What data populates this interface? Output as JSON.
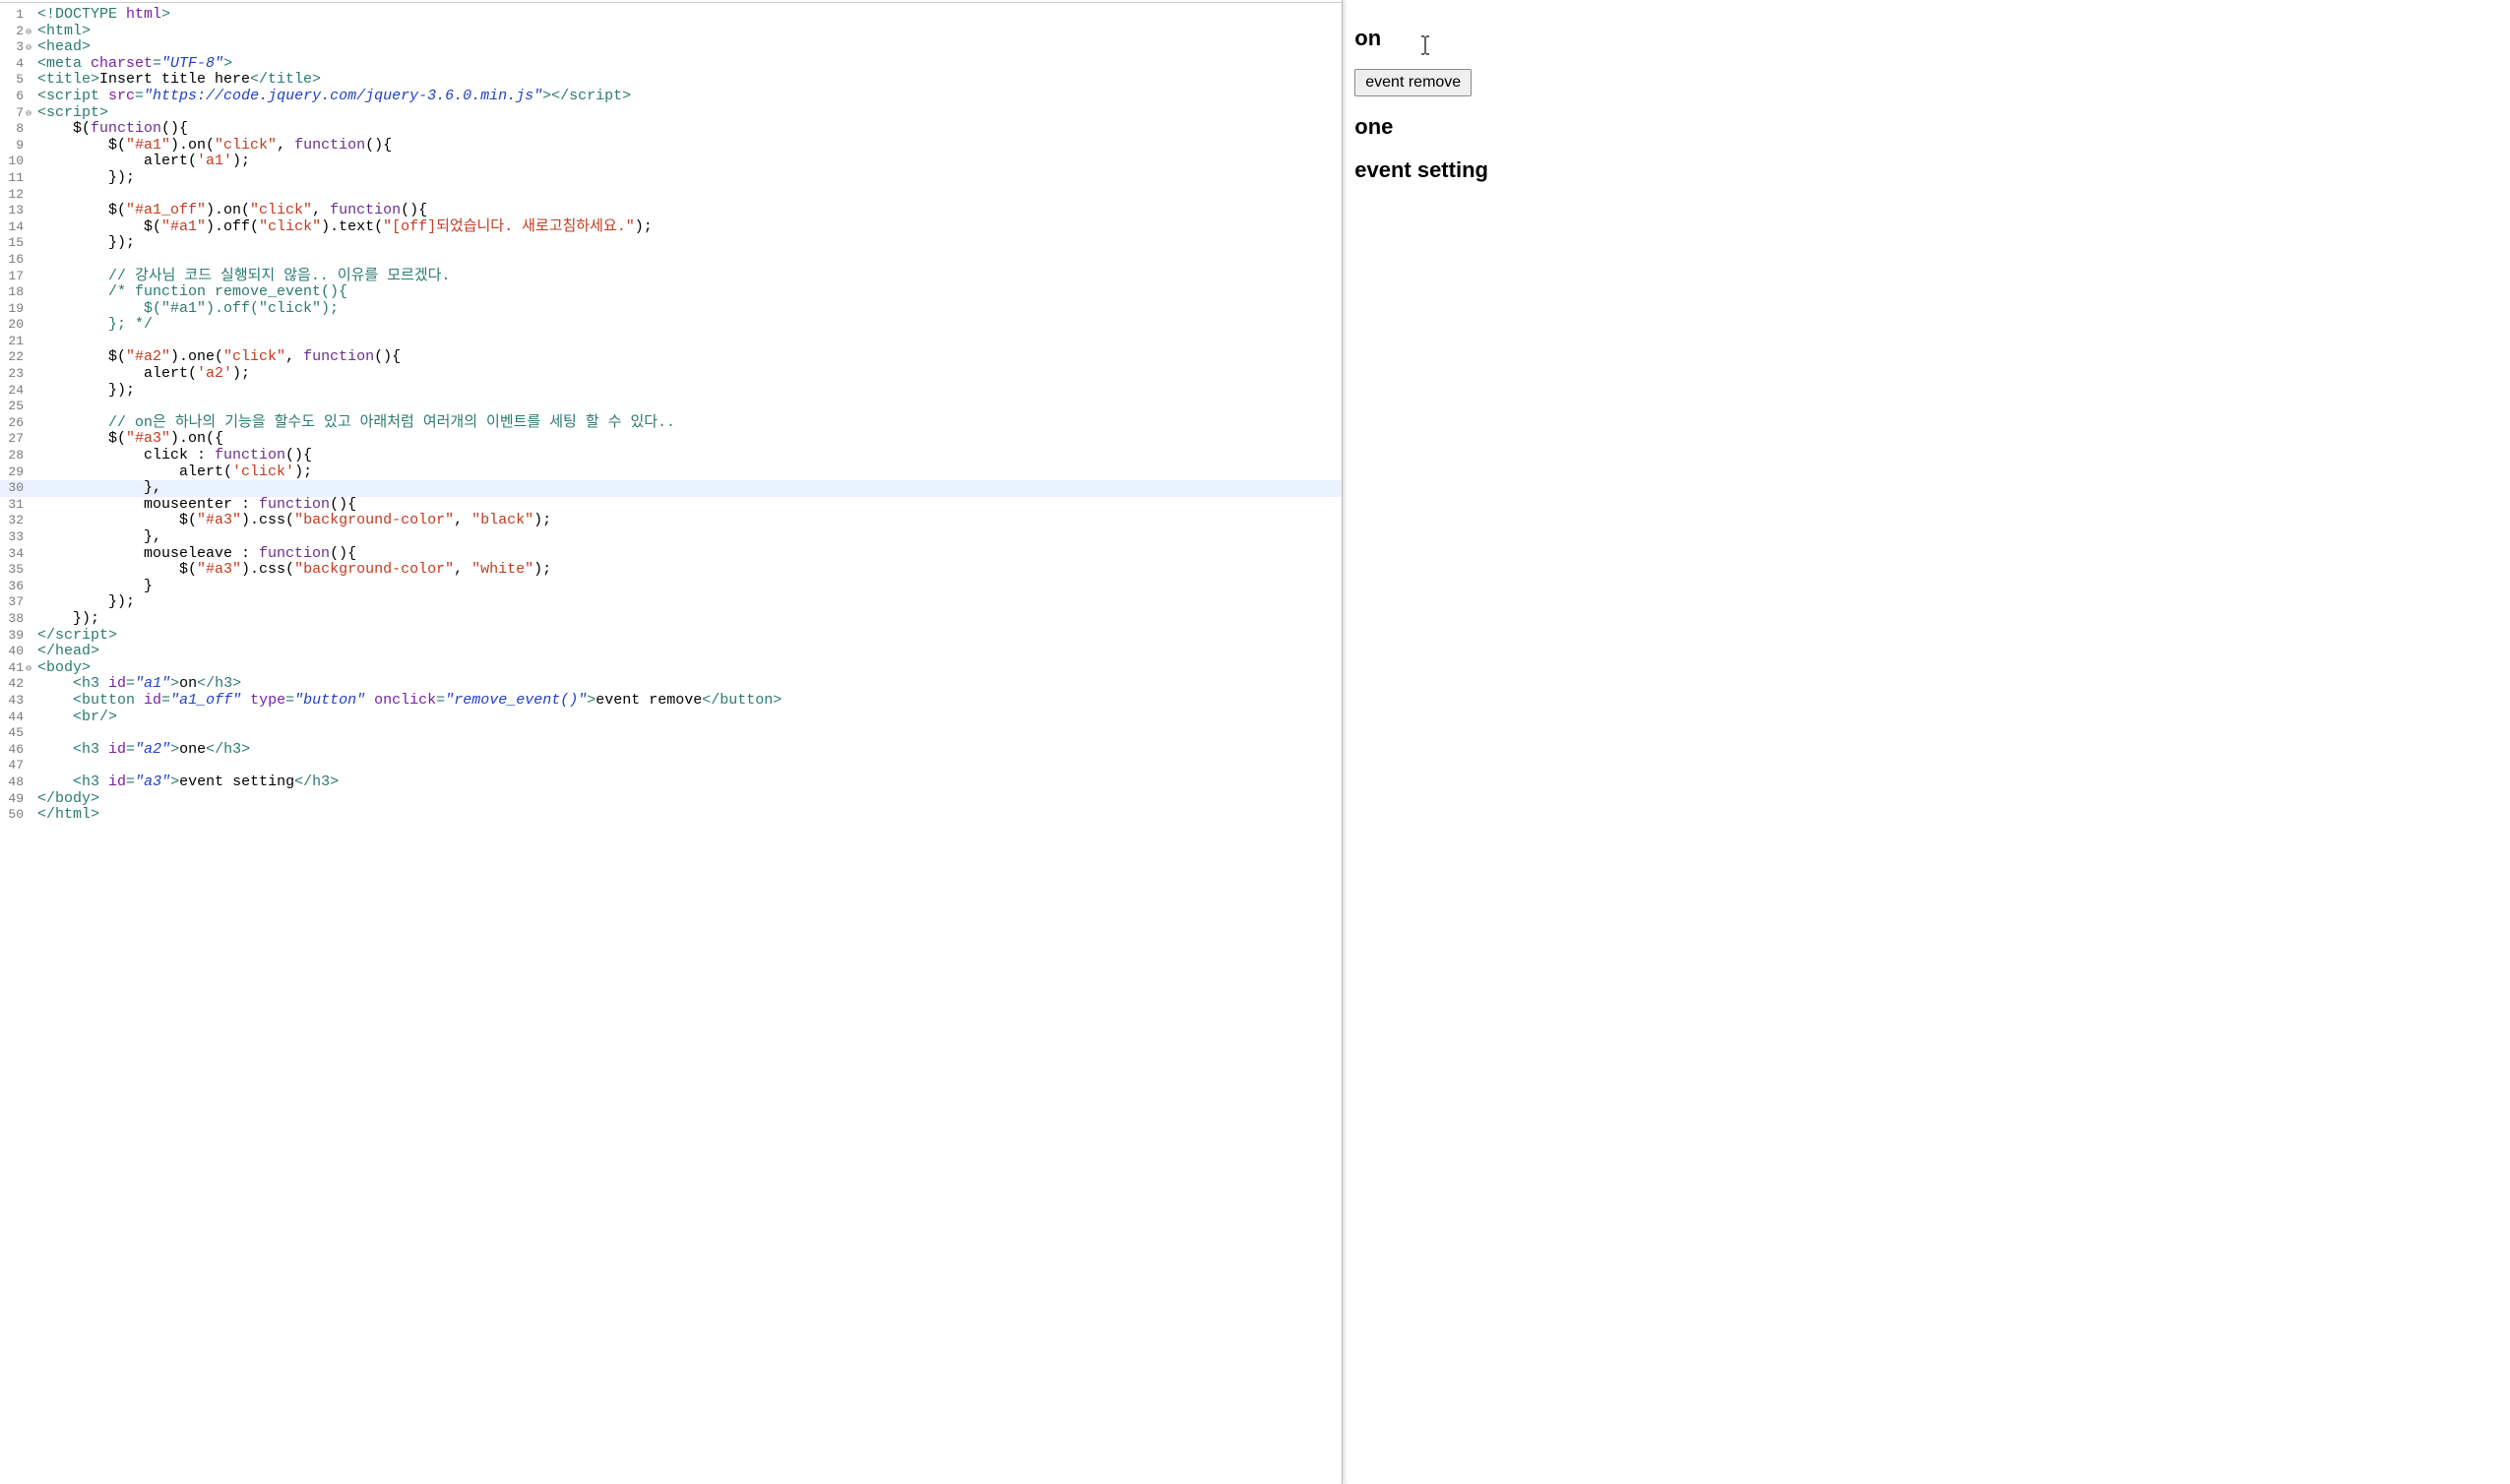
{
  "preview": {
    "h_on": "on",
    "btn_remove": "event remove",
    "h_one": "one",
    "h_setting": "event setting"
  },
  "fold_marks": {
    "1": "",
    "2": "⊖",
    "3": "⊖",
    "7": "⊖",
    "41": "⊖"
  },
  "code": [
    {
      "n": 1,
      "seg": [
        [
          "c-tag",
          "<!DOCTYPE "
        ],
        [
          "c-attr",
          "html"
        ],
        [
          "c-tag",
          ">"
        ]
      ]
    },
    {
      "n": 2,
      "seg": [
        [
          "c-tag",
          "<html>"
        ]
      ]
    },
    {
      "n": 3,
      "seg": [
        [
          "c-tag",
          "<head>"
        ]
      ]
    },
    {
      "n": 4,
      "seg": [
        [
          "c-tag",
          "<meta "
        ],
        [
          "c-attr",
          "charset"
        ],
        [
          "c-tag",
          "="
        ],
        [
          "c-str",
          "\"UTF-8\""
        ],
        [
          "c-tag",
          ">"
        ]
      ]
    },
    {
      "n": 5,
      "seg": [
        [
          "c-tag",
          "<title>"
        ],
        [
          "c-plain",
          "Insert title here"
        ],
        [
          "c-tag",
          "</title>"
        ]
      ]
    },
    {
      "n": 6,
      "seg": [
        [
          "c-tag",
          "<script "
        ],
        [
          "c-attr",
          "src"
        ],
        [
          "c-tag",
          "="
        ],
        [
          "c-str",
          "\"https://code.jquery.com/jquery-3.6.0.min.js\""
        ],
        [
          "c-tag",
          "></script>"
        ]
      ]
    },
    {
      "n": 7,
      "seg": [
        [
          "c-tag",
          "<script>"
        ]
      ]
    },
    {
      "n": 8,
      "seg": [
        [
          "c-plain",
          "    $("
        ],
        [
          "c-func",
          "function"
        ],
        [
          "c-plain",
          "(){"
        ]
      ]
    },
    {
      "n": 9,
      "seg": [
        [
          "c-plain",
          "        $("
        ],
        [
          "c-strred",
          "\"#a1\""
        ],
        [
          "c-plain",
          ").on("
        ],
        [
          "c-strred",
          "\"click\""
        ],
        [
          "c-plain",
          ", "
        ],
        [
          "c-func",
          "function"
        ],
        [
          "c-plain",
          "(){"
        ]
      ]
    },
    {
      "n": 10,
      "seg": [
        [
          "c-plain",
          "            alert("
        ],
        [
          "c-strred",
          "'a1'"
        ],
        [
          "c-plain",
          ");"
        ]
      ]
    },
    {
      "n": 11,
      "seg": [
        [
          "c-plain",
          "        });"
        ]
      ]
    },
    {
      "n": 12,
      "seg": [
        [
          "c-plain",
          ""
        ]
      ]
    },
    {
      "n": 13,
      "seg": [
        [
          "c-plain",
          "        $("
        ],
        [
          "c-strred",
          "\"#a1_off\""
        ],
        [
          "c-plain",
          ").on("
        ],
        [
          "c-strred",
          "\"click\""
        ],
        [
          "c-plain",
          ", "
        ],
        [
          "c-func",
          "function"
        ],
        [
          "c-plain",
          "(){"
        ]
      ]
    },
    {
      "n": 14,
      "seg": [
        [
          "c-plain",
          "            $("
        ],
        [
          "c-strred",
          "\"#a1\""
        ],
        [
          "c-plain",
          ").off("
        ],
        [
          "c-strred",
          "\"click\""
        ],
        [
          "c-plain",
          ").text("
        ],
        [
          "c-strred",
          "\"[off]되었습니다. 새로고침하세요.\""
        ],
        [
          "c-plain",
          ");"
        ]
      ]
    },
    {
      "n": 15,
      "seg": [
        [
          "c-plain",
          "        });"
        ]
      ]
    },
    {
      "n": 16,
      "seg": [
        [
          "c-plain",
          ""
        ]
      ]
    },
    {
      "n": 17,
      "seg": [
        [
          "c-plain",
          "        "
        ],
        [
          "c-comment",
          "// 강사님 코드 실행되지 않음.. 이유를 모르겠다."
        ]
      ]
    },
    {
      "n": 18,
      "seg": [
        [
          "c-plain",
          "        "
        ],
        [
          "c-comment",
          "/* function remove_event(){"
        ]
      ]
    },
    {
      "n": 19,
      "seg": [
        [
          "c-plain",
          "            "
        ],
        [
          "c-comment",
          "$(\"#a1\").off(\"click\");"
        ]
      ]
    },
    {
      "n": 20,
      "seg": [
        [
          "c-plain",
          "        "
        ],
        [
          "c-comment",
          "}; */"
        ]
      ]
    },
    {
      "n": 21,
      "seg": [
        [
          "c-plain",
          ""
        ]
      ]
    },
    {
      "n": 22,
      "seg": [
        [
          "c-plain",
          "        $("
        ],
        [
          "c-strred",
          "\"#a2\""
        ],
        [
          "c-plain",
          ").one("
        ],
        [
          "c-strred",
          "\"click\""
        ],
        [
          "c-plain",
          ", "
        ],
        [
          "c-func",
          "function"
        ],
        [
          "c-plain",
          "(){"
        ]
      ]
    },
    {
      "n": 23,
      "seg": [
        [
          "c-plain",
          "            alert("
        ],
        [
          "c-strred",
          "'a2'"
        ],
        [
          "c-plain",
          ");"
        ]
      ]
    },
    {
      "n": 24,
      "seg": [
        [
          "c-plain",
          "        });"
        ]
      ]
    },
    {
      "n": 25,
      "seg": [
        [
          "c-plain",
          ""
        ]
      ]
    },
    {
      "n": 26,
      "seg": [
        [
          "c-plain",
          "        "
        ],
        [
          "c-comment",
          "// on은 하나의 기능을 할수도 있고 아래처럼 여러개의 이벤트를 세팅 할 수 있다.."
        ]
      ]
    },
    {
      "n": 27,
      "seg": [
        [
          "c-plain",
          "        $("
        ],
        [
          "c-strred",
          "\"#a3\""
        ],
        [
          "c-plain",
          ").on({"
        ]
      ]
    },
    {
      "n": 28,
      "seg": [
        [
          "c-plain",
          "            click : "
        ],
        [
          "c-func",
          "function"
        ],
        [
          "c-plain",
          "(){"
        ]
      ]
    },
    {
      "n": 29,
      "seg": [
        [
          "c-plain",
          "                alert("
        ],
        [
          "c-strred",
          "'click'"
        ],
        [
          "c-plain",
          ");"
        ]
      ]
    },
    {
      "n": 30,
      "hl": true,
      "seg": [
        [
          "c-plain",
          "            },"
        ]
      ]
    },
    {
      "n": 31,
      "seg": [
        [
          "c-plain",
          "            mouseenter : "
        ],
        [
          "c-func",
          "function"
        ],
        [
          "c-plain",
          "(){"
        ]
      ]
    },
    {
      "n": 32,
      "seg": [
        [
          "c-plain",
          "                $("
        ],
        [
          "c-strred",
          "\"#a3\""
        ],
        [
          "c-plain",
          ").css("
        ],
        [
          "c-strred",
          "\"background-color\""
        ],
        [
          "c-plain",
          ", "
        ],
        [
          "c-strred",
          "\"black\""
        ],
        [
          "c-plain",
          ");"
        ]
      ]
    },
    {
      "n": 33,
      "seg": [
        [
          "c-plain",
          "            },"
        ]
      ]
    },
    {
      "n": 34,
      "seg": [
        [
          "c-plain",
          "            mouseleave : "
        ],
        [
          "c-func",
          "function"
        ],
        [
          "c-plain",
          "(){"
        ]
      ]
    },
    {
      "n": 35,
      "seg": [
        [
          "c-plain",
          "                $("
        ],
        [
          "c-strred",
          "\"#a3\""
        ],
        [
          "c-plain",
          ").css("
        ],
        [
          "c-strred",
          "\"background-color\""
        ],
        [
          "c-plain",
          ", "
        ],
        [
          "c-strred",
          "\"white\""
        ],
        [
          "c-plain",
          ");"
        ]
      ]
    },
    {
      "n": 36,
      "seg": [
        [
          "c-plain",
          "            }"
        ]
      ]
    },
    {
      "n": 37,
      "seg": [
        [
          "c-plain",
          "        });"
        ]
      ]
    },
    {
      "n": 38,
      "seg": [
        [
          "c-plain",
          "    });"
        ]
      ]
    },
    {
      "n": 39,
      "seg": [
        [
          "c-tag",
          "</script>"
        ]
      ]
    },
    {
      "n": 40,
      "seg": [
        [
          "c-tag",
          "</head>"
        ]
      ]
    },
    {
      "n": 41,
      "seg": [
        [
          "c-tag",
          "<body>"
        ]
      ]
    },
    {
      "n": 42,
      "seg": [
        [
          "c-plain",
          "    "
        ],
        [
          "c-tag",
          "<h3 "
        ],
        [
          "c-attr",
          "id"
        ],
        [
          "c-tag",
          "="
        ],
        [
          "c-str",
          "\"a1\""
        ],
        [
          "c-tag",
          ">"
        ],
        [
          "c-plain",
          "on"
        ],
        [
          "c-tag",
          "</h3>"
        ]
      ]
    },
    {
      "n": 43,
      "seg": [
        [
          "c-plain",
          "    "
        ],
        [
          "c-tag",
          "<button "
        ],
        [
          "c-attr",
          "id"
        ],
        [
          "c-tag",
          "="
        ],
        [
          "c-str",
          "\"a1_off\""
        ],
        [
          "c-tag",
          " "
        ],
        [
          "c-attr",
          "type"
        ],
        [
          "c-tag",
          "="
        ],
        [
          "c-str",
          "\"button\""
        ],
        [
          "c-tag",
          " "
        ],
        [
          "c-attr",
          "onclick"
        ],
        [
          "c-tag",
          "="
        ],
        [
          "c-str",
          "\"remove_event()\""
        ],
        [
          "c-tag",
          ">"
        ],
        [
          "c-plain",
          "event remove"
        ],
        [
          "c-tag",
          "</button>"
        ]
      ]
    },
    {
      "n": 44,
      "seg": [
        [
          "c-plain",
          "    "
        ],
        [
          "c-tag",
          "<br/>"
        ]
      ]
    },
    {
      "n": 45,
      "seg": [
        [
          "c-plain",
          ""
        ]
      ]
    },
    {
      "n": 46,
      "seg": [
        [
          "c-plain",
          "    "
        ],
        [
          "c-tag",
          "<h3 "
        ],
        [
          "c-attr",
          "id"
        ],
        [
          "c-tag",
          "="
        ],
        [
          "c-str",
          "\"a2\""
        ],
        [
          "c-tag",
          ">"
        ],
        [
          "c-plain",
          "one"
        ],
        [
          "c-tag",
          "</h3>"
        ]
      ]
    },
    {
      "n": 47,
      "seg": [
        [
          "c-plain",
          ""
        ]
      ]
    },
    {
      "n": 48,
      "seg": [
        [
          "c-plain",
          "    "
        ],
        [
          "c-tag",
          "<h3 "
        ],
        [
          "c-attr",
          "id"
        ],
        [
          "c-tag",
          "="
        ],
        [
          "c-str",
          "\"a3\""
        ],
        [
          "c-tag",
          ">"
        ],
        [
          "c-plain",
          "event setting"
        ],
        [
          "c-tag",
          "</h3>"
        ]
      ]
    },
    {
      "n": 49,
      "seg": [
        [
          "c-tag",
          "</body>"
        ]
      ]
    },
    {
      "n": 50,
      "seg": [
        [
          "c-tag",
          "</html>"
        ]
      ]
    }
  ]
}
